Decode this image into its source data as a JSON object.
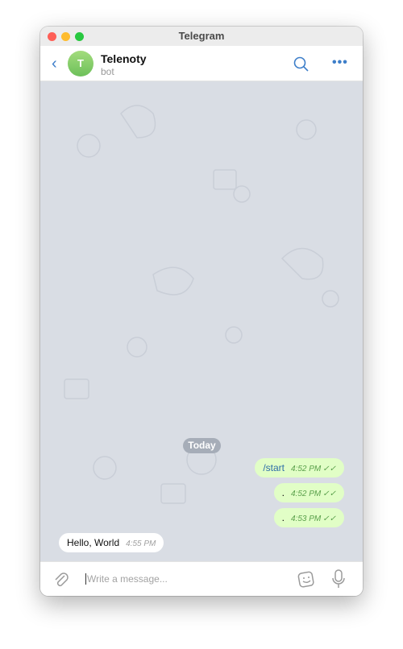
{
  "window": {
    "title": "Telegram"
  },
  "header": {
    "name": "Telenoty",
    "status": "bot",
    "avatar_letter": "T"
  },
  "chat": {
    "date_label": "Today",
    "messages": [
      {
        "direction": "out",
        "text": "/start",
        "time": "4:52 PM"
      },
      {
        "direction": "out",
        "text": ".",
        "time": "4:52 PM"
      },
      {
        "direction": "out",
        "text": ".",
        "time": "4:53 PM"
      },
      {
        "direction": "in",
        "text": "Hello, World",
        "time": "4:55 PM"
      }
    ]
  },
  "composer": {
    "placeholder": "Write a message..."
  },
  "colors": {
    "accent": "#3d7ec9",
    "outgoing": "#e1fec6",
    "background": "#d9dde4"
  }
}
